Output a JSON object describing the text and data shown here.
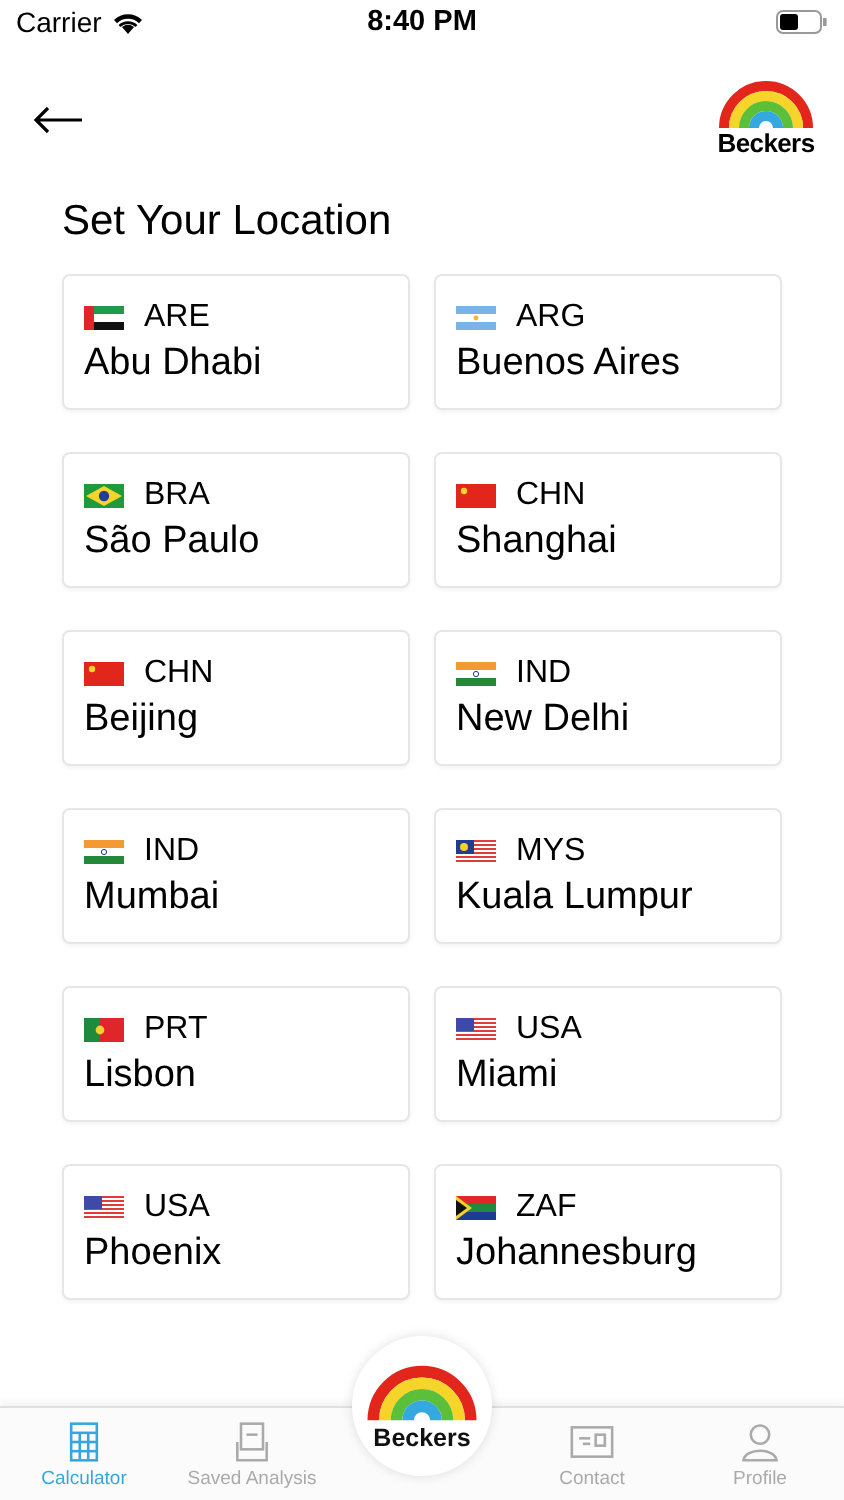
{
  "status_bar": {
    "carrier": "Carrier",
    "time": "8:40 PM"
  },
  "header": {
    "logo_text": "Beckers"
  },
  "title": "Set Your Location",
  "locations": [
    {
      "kind": "are",
      "code": "ARE",
      "city": "Abu Dhabi"
    },
    {
      "kind": "arg",
      "code": "ARG",
      "city": "Buenos Aires"
    },
    {
      "kind": "bra",
      "code": "BRA",
      "city": "São Paulo"
    },
    {
      "kind": "chn",
      "code": "CHN",
      "city": "Shanghai"
    },
    {
      "kind": "chn",
      "code": "CHN",
      "city": "Beijing"
    },
    {
      "kind": "ind",
      "code": "IND",
      "city": "New Delhi"
    },
    {
      "kind": "ind",
      "code": "IND",
      "city": "Mumbai"
    },
    {
      "kind": "mys",
      "code": "MYS",
      "city": "Kuala Lumpur"
    },
    {
      "kind": "prt",
      "code": "PRT",
      "city": "Lisbon"
    },
    {
      "kind": "usa",
      "code": "USA",
      "city": "Miami"
    },
    {
      "kind": "usa",
      "code": "USA",
      "city": "Phoenix"
    },
    {
      "kind": "zaf",
      "code": "ZAF",
      "city": "Johannesburg"
    }
  ],
  "tab_bar": {
    "center_logo_text": "Beckers",
    "tabs": [
      {
        "kind": "calculator",
        "label": "Calculator",
        "selected": true
      },
      {
        "kind": "saved",
        "label": "Saved Analysis",
        "selected": false
      },
      {
        "kind": "contact",
        "label": "Contact",
        "selected": false
      },
      {
        "kind": "profile",
        "label": "Profile",
        "selected": false
      }
    ]
  }
}
